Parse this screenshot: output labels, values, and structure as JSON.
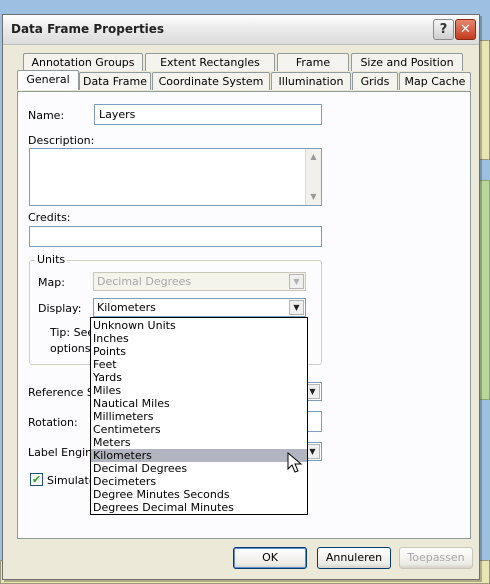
{
  "window": {
    "title": "Data Frame Properties",
    "help_glyph": "?",
    "close_glyph": "✕"
  },
  "tabs_back": [
    "Annotation Groups",
    "Extent Rectangles",
    "Frame",
    "Size and Position"
  ],
  "tabs_front": [
    "General",
    "Data Frame",
    "Coordinate System",
    "Illumination",
    "Grids",
    "Map Cache"
  ],
  "active_tab": "General",
  "general": {
    "name_label": "Name:",
    "name_value": "Layers",
    "description_label": "Description:",
    "credits_label": "Credits:",
    "units_group": "Units",
    "map_label": "Map:",
    "map_value": "Decimal Degrees",
    "display_label": "Display:",
    "display_value": "Kilometers",
    "tip_line1": "Tip: See",
    "tip_line2": "options f",
    "reference_scale_label": "Reference Sc",
    "rotation_label": "Rotation:",
    "label_engine_label": "Label Engine:",
    "simulate_label": "Simulate l",
    "simulate_checked": true
  },
  "dropdown": {
    "options": [
      "Unknown Units",
      "Inches",
      "Points",
      "Feet",
      "Yards",
      "Miles",
      "Nautical Miles",
      "Millimeters",
      "Centimeters",
      "Meters",
      "Kilometers",
      "Decimal Degrees",
      "Decimeters",
      "Degree Minutes Seconds",
      "Degrees Decimal Minutes"
    ],
    "selected": "Kilometers"
  },
  "buttons": {
    "ok": "OK",
    "cancel": "Annuleren",
    "apply": "Toepassen"
  },
  "icons": {
    "combo_arrow": "▼",
    "scroll_up": "▲",
    "scroll_down": "▼",
    "check": "✔"
  }
}
